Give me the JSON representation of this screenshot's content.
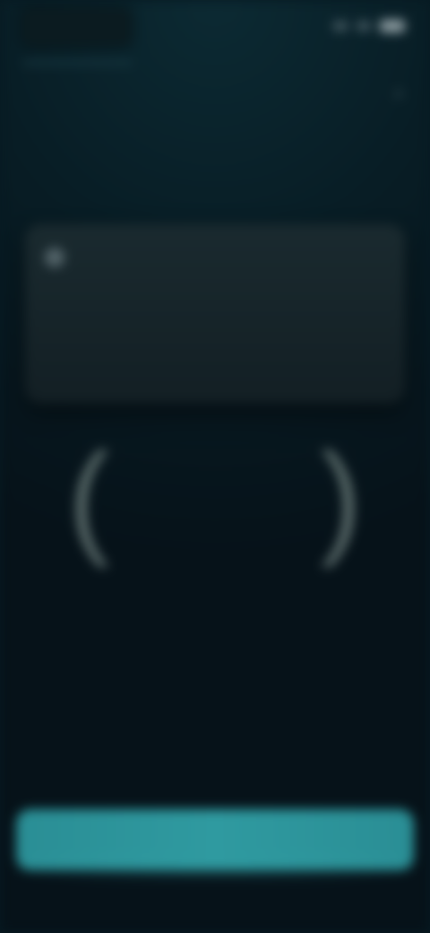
{
  "status": {
    "time": "",
    "icons": [
      "signal-icon",
      "wifi-icon",
      "battery-icon"
    ]
  },
  "header": {
    "title_line_1": "",
    "title_line_2": ""
  },
  "card": {
    "icon": "info-icon",
    "text_line_1": "",
    "text_line_2": "",
    "text_line_3": ""
  },
  "counter": {
    "value": "",
    "caption": ""
  },
  "cta": {
    "label": ""
  },
  "theme": {
    "accent": "#2f9aa0",
    "background": "#071a22",
    "card": "#172327"
  }
}
